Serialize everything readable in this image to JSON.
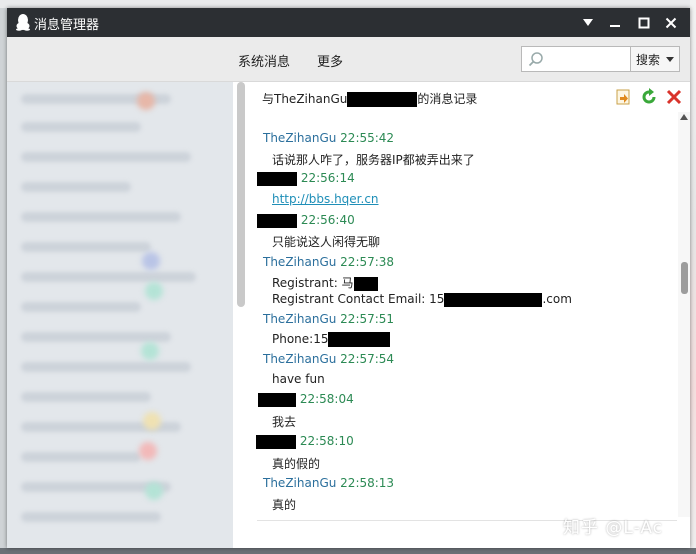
{
  "window": {
    "title": "消息管理器",
    "minimize_label": "▼",
    "maximize_label": "■",
    "close_label": "✕"
  },
  "toolbar": {
    "tabs": [
      "系统消息",
      "更多"
    ],
    "search_placeholder": "",
    "search_button": "搜索"
  },
  "chat": {
    "title_prefix": "与TheZihanGu",
    "title_suffix": "的消息记录",
    "messages": [
      {
        "sender": "TheZihanGu",
        "time": "22:55:42",
        "lines": [
          "话说那人咋了，服务器IP都被弄出来了"
        ]
      },
      {
        "sender": "",
        "time": "22:56:14",
        "lines": [
          "http://bbs.hqer.cn"
        ],
        "link": true
      },
      {
        "sender": "",
        "time": "22:56:40",
        "lines": [
          "只能说这人闲得无聊"
        ]
      },
      {
        "sender": "TheZihanGu",
        "time": "22:57:38",
        "lines": [
          "Registrant: 马",
          "Registrant Contact Email: 15",
          ".com"
        ]
      },
      {
        "sender": "TheZihanGu",
        "time": "22:57:51",
        "lines": [
          "Phone:15"
        ]
      },
      {
        "sender": "TheZihanGu",
        "time": "22:57:54",
        "lines": [
          "have fun"
        ]
      },
      {
        "sender": "",
        "time": "22:58:04",
        "lines": [
          "我去"
        ]
      },
      {
        "sender": "",
        "time": "22:58:10",
        "lines": [
          "真的假的"
        ]
      },
      {
        "sender": "TheZihanGu",
        "time": "22:58:13",
        "lines": [
          "真的"
        ]
      }
    ]
  },
  "watermark": "知乎 @L-Ac",
  "colors": {
    "titlebar": "#2c2f33",
    "sender": "#2b6f9c",
    "timestamp": "#2c8a54",
    "link": "#1f8fb8"
  }
}
